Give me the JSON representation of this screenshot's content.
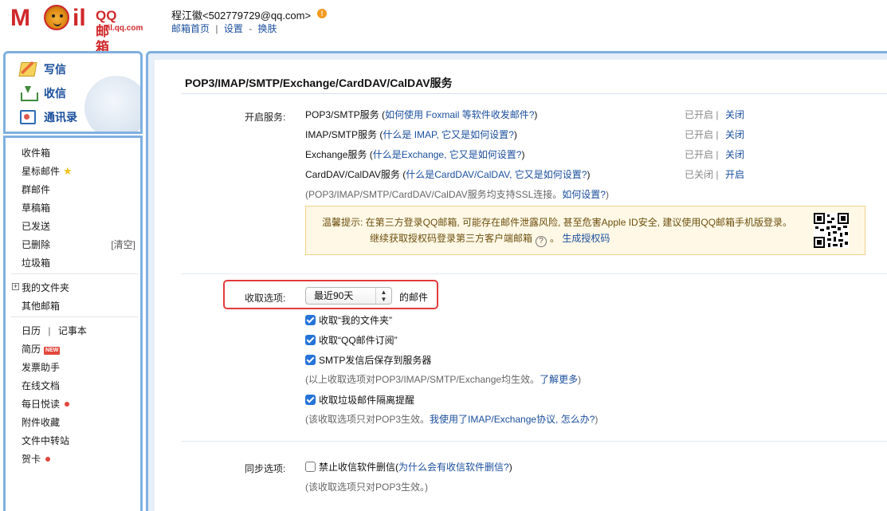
{
  "header": {
    "logo_text": "M",
    "logo_tail": "il",
    "logo_brand": "QQ邮箱",
    "logo_url": "mail.qq.com",
    "user_email": "程江徽<502779729@qq.com>",
    "warn_glyph": "!",
    "link_home": "邮箱首页",
    "link_sep": "|",
    "link_settings": "设置",
    "link_dash": "-",
    "link_skin": "换肤"
  },
  "sidebar": {
    "compose": "写信",
    "receive": "收信",
    "contacts": "通讯录",
    "folders": {
      "inbox": "收件箱",
      "starred": "星标邮件",
      "group": "群邮件",
      "drafts": "草稿箱",
      "sent": "已发送",
      "deleted": "已删除",
      "clear": "[清空]",
      "spam": "垃圾箱"
    },
    "my_folders": "我的文件夹",
    "other_mailboxes": "其他邮箱",
    "calendar": "日历",
    "cal_sep": "|",
    "notes": "记事本",
    "resume": "简历",
    "new_badge": "NEW",
    "invoice": "发票助手",
    "online_docs": "在线文档",
    "daily": "每日悦读",
    "attachments": "附件收藏",
    "file_transfer": "文件中转站",
    "cards": "贺卡"
  },
  "main": {
    "title": "POP3/IMAP/SMTP/Exchange/CardDAV/CalDAV服务",
    "open_service_label": "开启服务:",
    "services": [
      {
        "name": "POP3/SMTP服务",
        "paren_open": " (",
        "help": "如何使用 Foxmail 等软件收发邮件?",
        "paren_close": ")",
        "status": "已开启",
        "sep": "|",
        "action": "关闭"
      },
      {
        "name": "IMAP/SMTP服务",
        "paren_open": " (",
        "help": "什么是 IMAP, 它又是如何设置?",
        "paren_close": ")",
        "status": "已开启",
        "sep": "|",
        "action": "关闭"
      },
      {
        "name": "Exchange服务",
        "paren_open": " (",
        "help": "什么是Exchange, 它又是如何设置?",
        "paren_close": ")",
        "status": "已开启",
        "sep": "|",
        "action": "关闭"
      },
      {
        "name": "CardDAV/CalDAV服务",
        "paren_open": " (",
        "help": "什么是CardDAV/CalDAV, 它又是如何设置?",
        "paren_close": ")",
        "status": "已关闭",
        "sep": "|",
        "action": "开启"
      }
    ],
    "ssl_note_prefix": "(POP3/IMAP/SMTP/CardDAV/CalDAV服务均支持SSL连接。",
    "ssl_note_link": "如何设置?",
    "ssl_note_suffix": ")",
    "tip_line1": "温馨提示: 在第三方登录QQ邮箱, 可能存在邮件泄露风险, 甚至危害Apple ID安全, 建议使用QQ邮箱手机版登录。",
    "tip_line2": "继续获取授权码登录第三方客户端邮箱",
    "tip_help": "?",
    "tip_period": "。",
    "tip_link": "生成授权码",
    "fetch_label": "收取选项:",
    "fetch_select": "最近90天",
    "fetch_arrow_up": "▲",
    "fetch_arrow_down": "▼",
    "fetch_suffix": "的邮件",
    "fetch_options": [
      {
        "label": "收取“我的文件夹”",
        "checked": true
      },
      {
        "label": "收取“QQ邮件订阅”",
        "checked": true
      },
      {
        "label": "SMTP发信后保存到服务器",
        "checked": true
      }
    ],
    "fetch_note_prefix": "(以上收取选项对POP3/IMAP/SMTP/Exchange均生效。",
    "fetch_note_link": "了解更多",
    "fetch_note_suffix": ")",
    "spam_option": "收取垃圾邮件隔离提醒",
    "spam_note_prefix": "(该收取选项只对POP3生效。",
    "spam_note_link": "我使用了IMAP/Exchange协议, 怎么办?",
    "spam_note_suffix": ")",
    "sync_label": "同步选项:",
    "sync_option": "禁止收信软件删信",
    "sync_paren_open": " (",
    "sync_link": "为什么会有收信软件删信?",
    "sync_paren_close": ")",
    "sync_note": "(该收取选项只对POP3生效。)"
  },
  "colors": {
    "accent": "#1a4e9c",
    "brand_red": "#d0282b",
    "frame_blue": "#7fb0e0",
    "highlight": "#e23b3b",
    "checkbox": "#2673d9"
  }
}
